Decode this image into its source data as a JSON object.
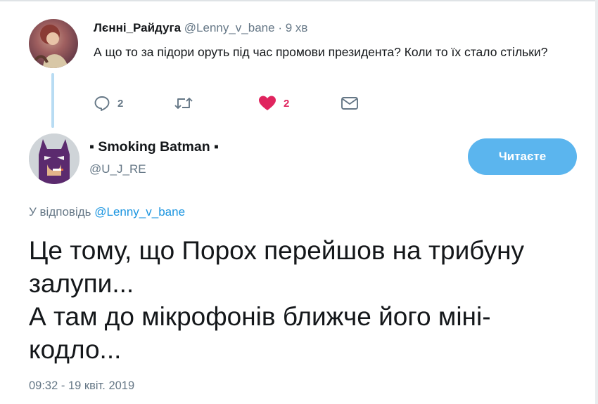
{
  "parent_tweet": {
    "author_name": "Лєнні_Райдуга",
    "handle": "@Lenny_v_bane",
    "separator": "·",
    "time": "9 хв",
    "text": "А що то за підори оруть під час промови президента? Коли то їх стало стільки?",
    "actions": {
      "reply_icon": "reply-icon",
      "reply_count": "2",
      "retweet_icon": "retweet-icon",
      "like_icon": "heart-icon",
      "like_count": "2",
      "dm_icon": "envelope-icon"
    },
    "like_color": "#e0245e"
  },
  "main_tweet": {
    "author_name": "▪ Smoking Batman ▪",
    "handle": "@U_J_RE",
    "follow_label": "Читаєте",
    "reply_prefix": "У відповідь",
    "reply_mention": "@Lenny_v_bane",
    "text_lines": [
      "Це тому, що Порох перейшов на трибуну",
      "залупи...",
      "А там до мікрофонів ближче його міні-",
      "кодло..."
    ],
    "timestamp": "09:32 - 19 квіт. 2019"
  },
  "colors": {
    "accent": "#1b95e0",
    "follow_button": "#5bb5ee",
    "secondary_text": "#657786",
    "thread_line": "#b8dcf3"
  }
}
